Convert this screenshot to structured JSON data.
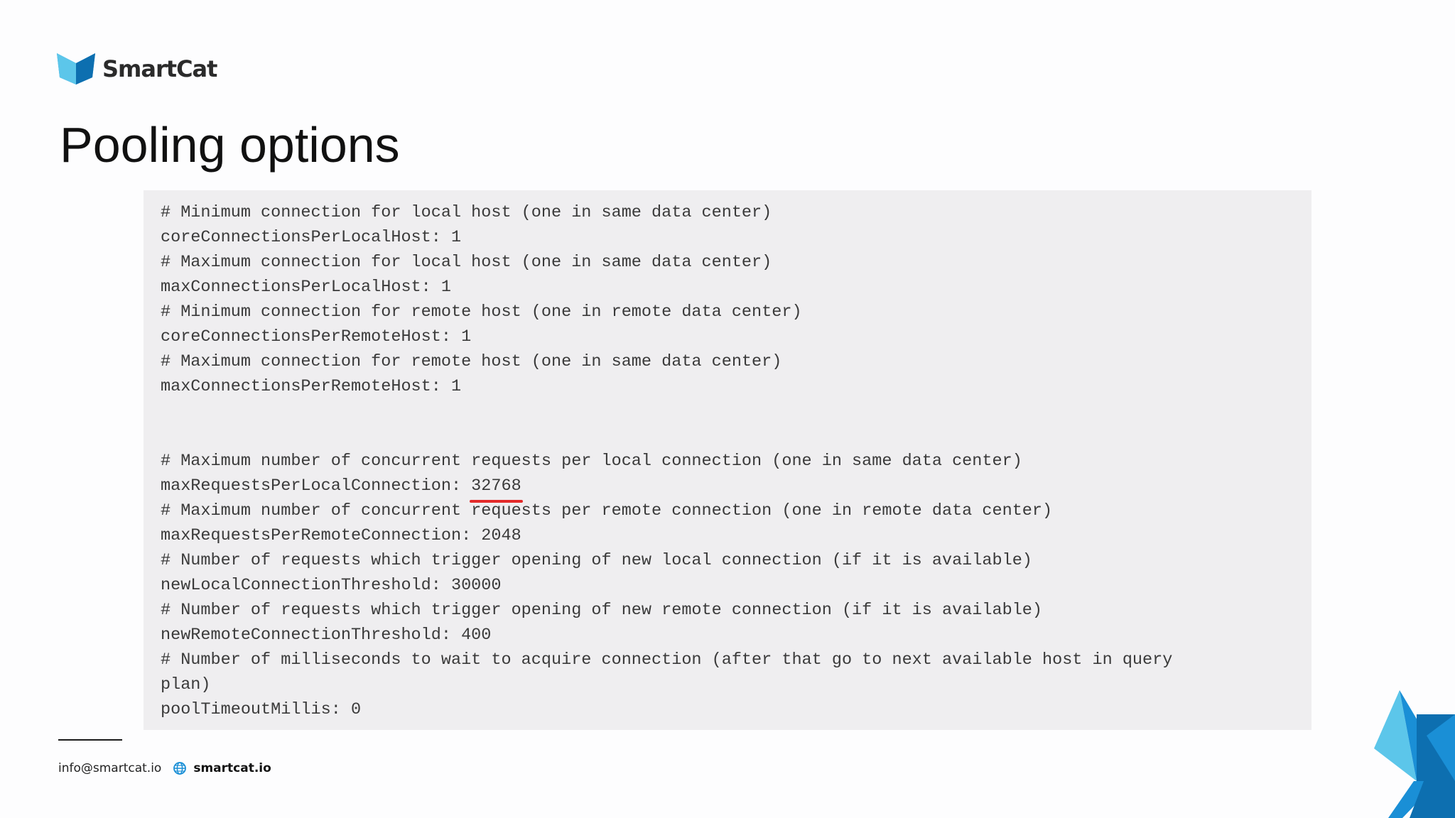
{
  "brand": {
    "name": "SmartCat",
    "logo_icon": "cat-head-icon",
    "colors": {
      "primary_blue": "#1a8fd6",
      "light_blue": "#5cc6ea",
      "dark_blue": "#0d6fb0",
      "highlight_red": "#e32a2a"
    }
  },
  "slide": {
    "title": "Pooling options"
  },
  "code": {
    "lines_top": [
      "# Minimum connection for local host (one in same data center)",
      "coreConnectionsPerLocalHost: 1",
      "# Maximum connection for local host (one in same data center)",
      "maxConnectionsPerLocalHost: 1",
      "# Minimum connection for remote host (one in remote data center)",
      "coreConnectionsPerRemoteHost: 1",
      "# Maximum connection for remote host (one in same data center)",
      "maxConnectionsPerRemoteHost: 1"
    ],
    "highlight_comment": "# Maximum number of concurrent requests per local connection (one in same data center)",
    "highlight_key": "maxRequestsPerLocalConnection: ",
    "highlight_value": "32768",
    "lines_bottom": [
      "# Maximum number of concurrent requests per remote connection (one in remote data center)",
      "maxRequestsPerRemoteConnection: 2048",
      "# Number of requests which trigger opening of new local connection (if it is available)",
      "newLocalConnectionThreshold: 30000",
      "# Number of requests which trigger opening of new remote connection (if it is available)",
      "newRemoteConnectionThreshold: 400",
      "# Number of milliseconds to wait to acquire connection (after that go to next available host in query",
      "plan)",
      "poolTimeoutMillis: 0"
    ]
  },
  "footer": {
    "email": "info@smartcat.io",
    "site_icon": "globe-icon",
    "website": "smartcat.io"
  },
  "decoration": {
    "corner_icon": "triangles-decoration"
  }
}
